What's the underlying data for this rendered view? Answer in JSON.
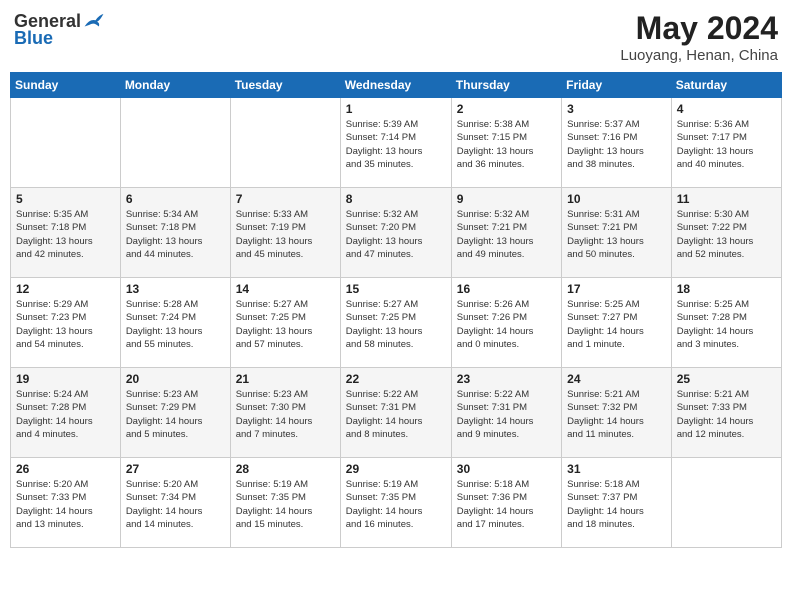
{
  "header": {
    "logo_general": "General",
    "logo_blue": "Blue",
    "title": "May 2024",
    "location": "Luoyang, Henan, China"
  },
  "days_of_week": [
    "Sunday",
    "Monday",
    "Tuesday",
    "Wednesday",
    "Thursday",
    "Friday",
    "Saturday"
  ],
  "weeks": [
    [
      {
        "day": "",
        "info": ""
      },
      {
        "day": "",
        "info": ""
      },
      {
        "day": "",
        "info": ""
      },
      {
        "day": "1",
        "info": "Sunrise: 5:39 AM\nSunset: 7:14 PM\nDaylight: 13 hours\nand 35 minutes."
      },
      {
        "day": "2",
        "info": "Sunrise: 5:38 AM\nSunset: 7:15 PM\nDaylight: 13 hours\nand 36 minutes."
      },
      {
        "day": "3",
        "info": "Sunrise: 5:37 AM\nSunset: 7:16 PM\nDaylight: 13 hours\nand 38 minutes."
      },
      {
        "day": "4",
        "info": "Sunrise: 5:36 AM\nSunset: 7:17 PM\nDaylight: 13 hours\nand 40 minutes."
      }
    ],
    [
      {
        "day": "5",
        "info": "Sunrise: 5:35 AM\nSunset: 7:18 PM\nDaylight: 13 hours\nand 42 minutes."
      },
      {
        "day": "6",
        "info": "Sunrise: 5:34 AM\nSunset: 7:18 PM\nDaylight: 13 hours\nand 44 minutes."
      },
      {
        "day": "7",
        "info": "Sunrise: 5:33 AM\nSunset: 7:19 PM\nDaylight: 13 hours\nand 45 minutes."
      },
      {
        "day": "8",
        "info": "Sunrise: 5:32 AM\nSunset: 7:20 PM\nDaylight: 13 hours\nand 47 minutes."
      },
      {
        "day": "9",
        "info": "Sunrise: 5:32 AM\nSunset: 7:21 PM\nDaylight: 13 hours\nand 49 minutes."
      },
      {
        "day": "10",
        "info": "Sunrise: 5:31 AM\nSunset: 7:21 PM\nDaylight: 13 hours\nand 50 minutes."
      },
      {
        "day": "11",
        "info": "Sunrise: 5:30 AM\nSunset: 7:22 PM\nDaylight: 13 hours\nand 52 minutes."
      }
    ],
    [
      {
        "day": "12",
        "info": "Sunrise: 5:29 AM\nSunset: 7:23 PM\nDaylight: 13 hours\nand 54 minutes."
      },
      {
        "day": "13",
        "info": "Sunrise: 5:28 AM\nSunset: 7:24 PM\nDaylight: 13 hours\nand 55 minutes."
      },
      {
        "day": "14",
        "info": "Sunrise: 5:27 AM\nSunset: 7:25 PM\nDaylight: 13 hours\nand 57 minutes."
      },
      {
        "day": "15",
        "info": "Sunrise: 5:27 AM\nSunset: 7:25 PM\nDaylight: 13 hours\nand 58 minutes."
      },
      {
        "day": "16",
        "info": "Sunrise: 5:26 AM\nSunset: 7:26 PM\nDaylight: 14 hours\nand 0 minutes."
      },
      {
        "day": "17",
        "info": "Sunrise: 5:25 AM\nSunset: 7:27 PM\nDaylight: 14 hours\nand 1 minute."
      },
      {
        "day": "18",
        "info": "Sunrise: 5:25 AM\nSunset: 7:28 PM\nDaylight: 14 hours\nand 3 minutes."
      }
    ],
    [
      {
        "day": "19",
        "info": "Sunrise: 5:24 AM\nSunset: 7:28 PM\nDaylight: 14 hours\nand 4 minutes."
      },
      {
        "day": "20",
        "info": "Sunrise: 5:23 AM\nSunset: 7:29 PM\nDaylight: 14 hours\nand 5 minutes."
      },
      {
        "day": "21",
        "info": "Sunrise: 5:23 AM\nSunset: 7:30 PM\nDaylight: 14 hours\nand 7 minutes."
      },
      {
        "day": "22",
        "info": "Sunrise: 5:22 AM\nSunset: 7:31 PM\nDaylight: 14 hours\nand 8 minutes."
      },
      {
        "day": "23",
        "info": "Sunrise: 5:22 AM\nSunset: 7:31 PM\nDaylight: 14 hours\nand 9 minutes."
      },
      {
        "day": "24",
        "info": "Sunrise: 5:21 AM\nSunset: 7:32 PM\nDaylight: 14 hours\nand 11 minutes."
      },
      {
        "day": "25",
        "info": "Sunrise: 5:21 AM\nSunset: 7:33 PM\nDaylight: 14 hours\nand 12 minutes."
      }
    ],
    [
      {
        "day": "26",
        "info": "Sunrise: 5:20 AM\nSunset: 7:33 PM\nDaylight: 14 hours\nand 13 minutes."
      },
      {
        "day": "27",
        "info": "Sunrise: 5:20 AM\nSunset: 7:34 PM\nDaylight: 14 hours\nand 14 minutes."
      },
      {
        "day": "28",
        "info": "Sunrise: 5:19 AM\nSunset: 7:35 PM\nDaylight: 14 hours\nand 15 minutes."
      },
      {
        "day": "29",
        "info": "Sunrise: 5:19 AM\nSunset: 7:35 PM\nDaylight: 14 hours\nand 16 minutes."
      },
      {
        "day": "30",
        "info": "Sunrise: 5:18 AM\nSunset: 7:36 PM\nDaylight: 14 hours\nand 17 minutes."
      },
      {
        "day": "31",
        "info": "Sunrise: 5:18 AM\nSunset: 7:37 PM\nDaylight: 14 hours\nand 18 minutes."
      },
      {
        "day": "",
        "info": ""
      }
    ]
  ]
}
